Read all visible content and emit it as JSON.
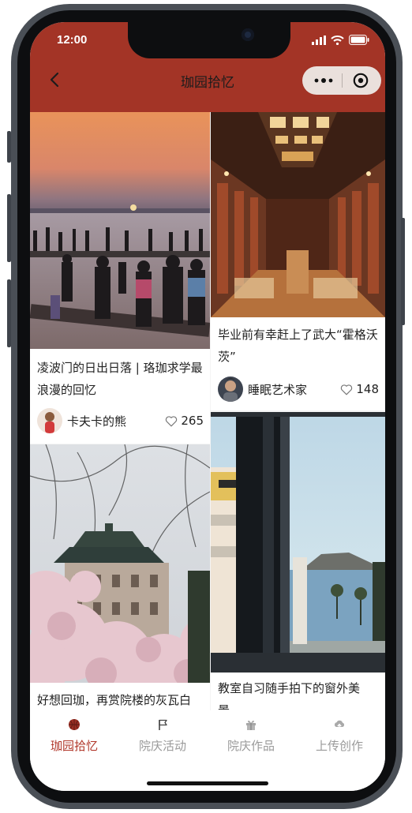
{
  "status": {
    "time": "12:00"
  },
  "nav": {
    "title": "珈园拾忆"
  },
  "feed": {
    "cards": [
      {
        "title": "凌波门的日出日落 | 珞珈求学最浪漫的回忆",
        "author": "卡夫卡的熊",
        "likes": "265"
      },
      {
        "title": "毕业前有幸赶上了武大“霍格沃茨”",
        "author": "睡眠艺术家",
        "likes": "148"
      },
      {
        "title": "好想回珈，再赏院楼的灰瓦白"
      },
      {
        "title": "教室自习随手拍下的窗外美景，"
      }
    ]
  },
  "tabs": [
    {
      "label": "珈园拾忆",
      "icon": "basketball-icon",
      "active": true
    },
    {
      "label": "院庆活动",
      "icon": "flag-icon"
    },
    {
      "label": "院庆作品",
      "icon": "gift-icon"
    },
    {
      "label": "上传创作",
      "icon": "upload-cloud-icon"
    }
  ],
  "colors": {
    "header": "#a33426",
    "accent": "#b1372a"
  }
}
